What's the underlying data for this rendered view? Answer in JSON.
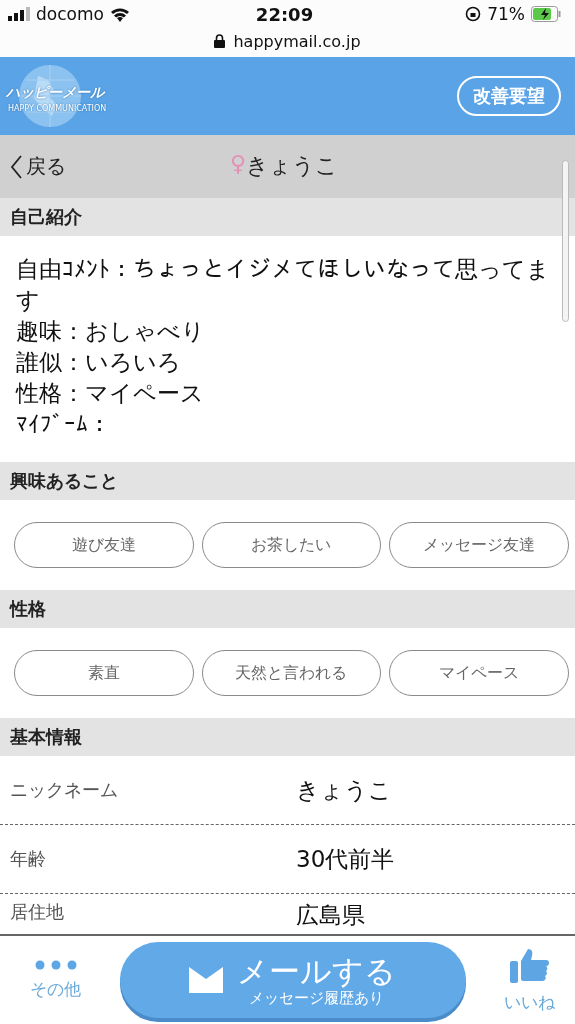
{
  "status_bar": {
    "carrier": "docomo",
    "time": "22:09",
    "battery": "71%",
    "url": "happymail.co.jp"
  },
  "header": {
    "logo_text": "ハッピーメール",
    "logo_subtext": "HAPPY COMMUNICATION",
    "button": "改善要望"
  },
  "nav": {
    "back": "戻る",
    "gender_symbol": "♀",
    "title": "きょうこ"
  },
  "sections": [
    {
      "kind": "text",
      "title": "自己紹介",
      "lines": [
        "自由ｺﾒﾝﾄ：ちょっとイジメてほしいなって思ってます",
        "趣味：おしゃべり",
        "誰似：いろいろ",
        "性格：マイペース",
        "ﾏｲﾌﾞｰﾑ："
      ]
    },
    {
      "kind": "chips",
      "title": "興味あること",
      "chips": [
        "遊び友達",
        "お茶したい",
        "メッセージ友達"
      ]
    },
    {
      "kind": "chips",
      "title": "性格",
      "chips": [
        "素直",
        "天然と言われる",
        "マイペース"
      ]
    },
    {
      "kind": "table",
      "title": "基本情報",
      "rows": [
        {
          "label": "ニックネーム",
          "value": "きょうこ"
        },
        {
          "label": "年齢",
          "value": "30代前半"
        },
        {
          "label": "居住地",
          "value": "広島県"
        }
      ]
    }
  ],
  "bottom_bar": {
    "other": "その他",
    "mail_button": "メールする",
    "mail_sub": "メッセージ履歴あり",
    "like": "いいね"
  }
}
